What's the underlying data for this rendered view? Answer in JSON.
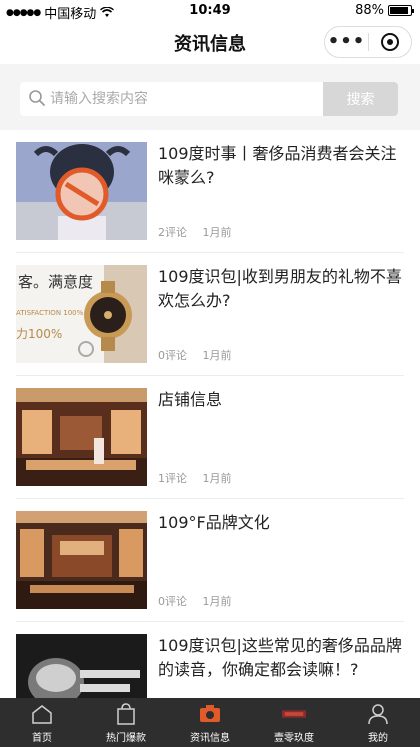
{
  "status": {
    "carrier": "中国移动",
    "time": "10:49",
    "battery": "88%",
    "battery_level": 0.88
  },
  "nav": {
    "title": "资讯信息"
  },
  "search": {
    "placeholder": "请输入搜索内容",
    "button_label": "搜索"
  },
  "articles": [
    {
      "title": "109度时事丨奢侈品消费者会关注咪蒙么?",
      "comments": "2评论",
      "time": "1月前",
      "thumb_text": ""
    },
    {
      "title": "109度识包|收到男朋友的礼物不喜欢怎么办?",
      "comments": "0评论",
      "time": "1月前",
      "thumb_text": "客。满意度",
      "thumb_text2": "ATISFACTION 100%",
      "thumb_text3": "力100%"
    },
    {
      "title": "店铺信息",
      "comments": "1评论",
      "time": "1月前"
    },
    {
      "title": "109°F品牌文化",
      "comments": "0评论",
      "time": "1月前"
    },
    {
      "title": "109度识包|这些常见的奢侈品品牌的读音，你确定都会读嘛！?",
      "comments": "",
      "time": ""
    }
  ],
  "tabs": [
    {
      "label": "首页",
      "icon": "home-icon"
    },
    {
      "label": "热门爆款",
      "icon": "bag-icon"
    },
    {
      "label": "资讯信息",
      "icon": "camera-icon"
    },
    {
      "label": "壹零玖度",
      "icon": "brand-icon"
    },
    {
      "label": "我的",
      "icon": "user-icon"
    }
  ],
  "colors": {
    "tab_bar": "#2e2e2e",
    "tab_active": "#e05a2a",
    "search_button": "#d7d7d7"
  }
}
